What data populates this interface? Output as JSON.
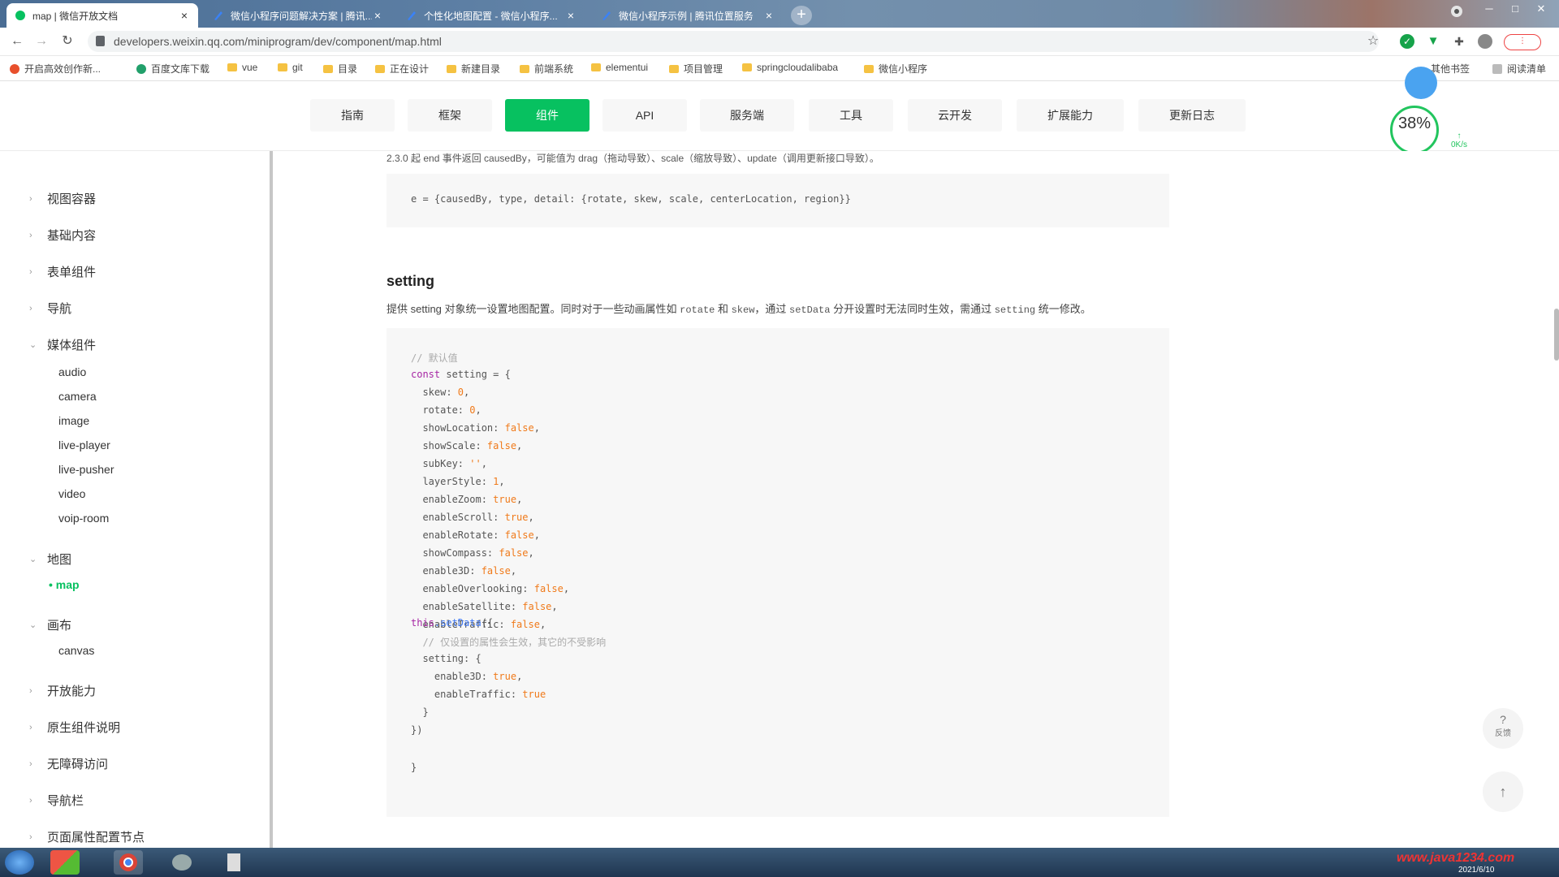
{
  "tabs": [
    {
      "title": "map | 微信开放文档",
      "active": true
    },
    {
      "title": "微信小程序问题解决方案 | 腾讯..."
    },
    {
      "title": "个性化地图配置 - 微信小程序..."
    },
    {
      "title": "微信小程序示例 | 腾讯位置服务"
    }
  ],
  "new_tab": "+",
  "url": "developers.weixin.qq.com/miniprogram/dev/component/map.html",
  "bookmarks": [
    "开启高效创作新...",
    "百度文库下载",
    "vue",
    "git",
    "目录",
    "正在设计",
    "新建目录",
    "前端系统",
    "elementui",
    "项目管理",
    "springcloudalibaba",
    "微信小程序"
  ],
  "bookmarks_right": [
    "其他书签",
    "阅读清单"
  ],
  "top_nav": [
    "指南",
    "框架",
    "组件",
    "API",
    "服务端",
    "工具",
    "云开发",
    "扩展能力",
    "更新日志"
  ],
  "top_nav_active": "组件",
  "perf": {
    "percent": "38%",
    "sub": "↑ 0K/s"
  },
  "sidebar": {
    "groups": [
      {
        "label": "视图容器",
        "chev": "›"
      },
      {
        "label": "基础内容",
        "chev": "›"
      },
      {
        "label": "表单组件",
        "chev": "›"
      },
      {
        "label": "导航",
        "chev": "›"
      },
      {
        "label": "媒体组件",
        "chev": "⌄"
      },
      {
        "label": "地图",
        "chev": "⌄"
      },
      {
        "label": "画布",
        "chev": "⌄"
      },
      {
        "label": "开放能力",
        "chev": "›"
      },
      {
        "label": "原生组件说明",
        "chev": "›"
      },
      {
        "label": "无障碍访问",
        "chev": "›"
      },
      {
        "label": "导航栏",
        "chev": "›"
      },
      {
        "label": "页面属性配置节点",
        "chev": "›"
      }
    ],
    "media_items": [
      "audio",
      "camera",
      "image",
      "live-player",
      "live-pusher",
      "video",
      "voip-room"
    ],
    "map_items": [
      "map"
    ],
    "canvas_items": [
      "canvas"
    ]
  },
  "content": {
    "top_note": "2.3.0 起 end 事件返回 causedBy，可能值为 drag（拖动导致）、scale（缩放导致）、update（调用更新接口导致）。",
    "event_code": "e = {causedBy, type, detail: {rotate, skew, scale, centerLocation, region}}",
    "heading": "setting",
    "para_text_1": "提供 setting 对象统一设置地图配置。同时对于一些动画属性如 ",
    "para_code_1": "rotate",
    "para_text_2": " 和 ",
    "para_code_2": "skew",
    "para_text_3": "，通过 ",
    "para_code_3": "setData",
    "para_text_4": " 分开设置时无法同时生效，需通过 ",
    "para_code_4": "setting",
    "para_text_5": " 统一修改。",
    "code": {
      "comment1": "// 默认值",
      "kw_const": "const",
      "decl": " setting = {",
      "props": [
        {
          "k": "  skew: ",
          "v": "0",
          "e": ","
        },
        {
          "k": "  rotate: ",
          "v": "0",
          "e": ","
        },
        {
          "k": "  showLocation: ",
          "v": "false",
          "e": ","
        },
        {
          "k": "  showScale: ",
          "v": "false",
          "e": ","
        },
        {
          "k": "  subKey: ",
          "v": "''",
          "e": ","
        },
        {
          "k": "  layerStyle: ",
          "v": "1",
          "e": ","
        },
        {
          "k": "  enableZoom: ",
          "v": "true",
          "e": ","
        },
        {
          "k": "  enableScroll: ",
          "v": "true",
          "e": ","
        },
        {
          "k": "  enableRotate: ",
          "v": "false",
          "e": ","
        },
        {
          "k": "  showCompass: ",
          "v": "false",
          "e": ","
        },
        {
          "k": "  enable3D: ",
          "v": "false",
          "e": ","
        },
        {
          "k": "  enableOverlooking: ",
          "v": "false",
          "e": ","
        },
        {
          "k": "  enableSatellite: ",
          "v": "false",
          "e": ","
        },
        {
          "k": "  enableTraffic: ",
          "v": "false",
          "e": ","
        }
      ],
      "close": "}",
      "this_kw": "this",
      "setdata_fn": ".setData",
      "setdata_open": "({",
      "comment2": "  // 仅设置的属性会生效，其它的不受影响",
      "setting_open": "  setting: {",
      "s1k": "    enable3D: ",
      "s1v": "true",
      "s1e": ",",
      "s2k": "    enableTraffic: ",
      "s2v": "true",
      "setting_close": "  }",
      "setdata_close": "})"
    }
  },
  "floats": {
    "feedback": "反馈",
    "to_top": "↑"
  },
  "taskbar": {
    "watermark": "www.java1234.com",
    "date": "2021/6/10"
  }
}
